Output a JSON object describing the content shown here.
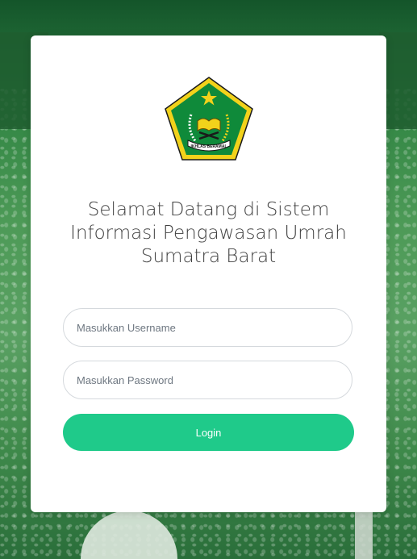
{
  "colors": {
    "primary_button": "#1fca8a",
    "background_green": "#2f8442"
  },
  "logo": {
    "icon": "kementerian-agama-emblem",
    "banner_text": "IKHLAS BERAMAL"
  },
  "welcome": {
    "line1": "Selamat Datang di Sistem",
    "line2": "Informasi Pengawasan Umrah",
    "line3": "Sumatra Barat"
  },
  "form": {
    "username_placeholder": "Masukkan Username",
    "password_placeholder": "Masukkan Password",
    "login_label": "Login"
  }
}
